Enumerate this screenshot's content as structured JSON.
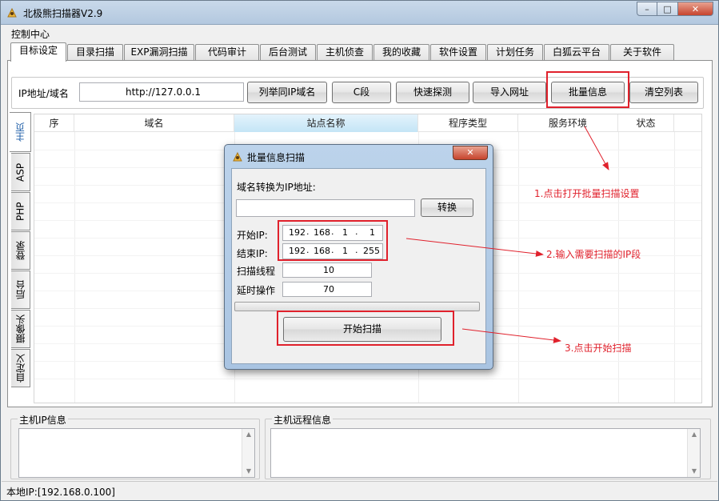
{
  "window": {
    "title": "北极熊扫描器V2.9",
    "min_symbol": "–",
    "max_symbol": "□",
    "close_symbol": "✕"
  },
  "menu": {
    "label": "控制中心"
  },
  "tabs": [
    "目标设定",
    "目录扫描",
    "EXP漏洞扫描",
    "代码审计",
    "后台测试",
    "主机侦查",
    "我的收藏",
    "软件设置",
    "计划任务",
    "白狐云平台",
    "关于软件"
  ],
  "toolbar": {
    "ip_label": "IP地址/域名",
    "url_value": "http://127.0.0.1",
    "list_same_ip": "列举同IP域名",
    "c_segment": "C段",
    "quick_probe": "快速探测",
    "import_url": "导入网址",
    "batch_info": "批量信息",
    "clear_list": "清空列表"
  },
  "side_tabs": [
    "主页",
    "ASP",
    "PHP",
    "登录",
    "后台",
    "摄像头",
    "自定义"
  ],
  "grid": {
    "columns": [
      "序",
      "域名",
      "站点名称",
      "程序类型",
      "服务环境",
      "状态"
    ]
  },
  "bottom": {
    "host_ip_info": "主机IP信息",
    "host_remote_info": "主机远程信息"
  },
  "status": {
    "local_ip": "本地IP:[192.168.0.100]"
  },
  "dialog": {
    "title": "批量信息扫描",
    "domain_to_ip_label": "域名转换为IP地址:",
    "domain_input_value": "",
    "convert_button": "转换",
    "start_ip_label": "开始IP:",
    "start_ip": [
      "192",
      "168",
      "1",
      "1"
    ],
    "end_ip_label": "结束IP:",
    "end_ip": [
      "192",
      "168",
      "1",
      "255"
    ],
    "threads_label": "扫描线程",
    "threads_value": "10",
    "delay_label": "延时操作",
    "delay_value": "70",
    "start_button": "开始扫描",
    "progress": 0
  },
  "annotations": {
    "step1": "1.点击打开批量扫描设置",
    "step2": "2.输入需要扫描的IP段",
    "step3": "3.点击开始扫描"
  },
  "colors": {
    "highlight": "#e0212c",
    "selected_header": "#c4e5f6"
  }
}
